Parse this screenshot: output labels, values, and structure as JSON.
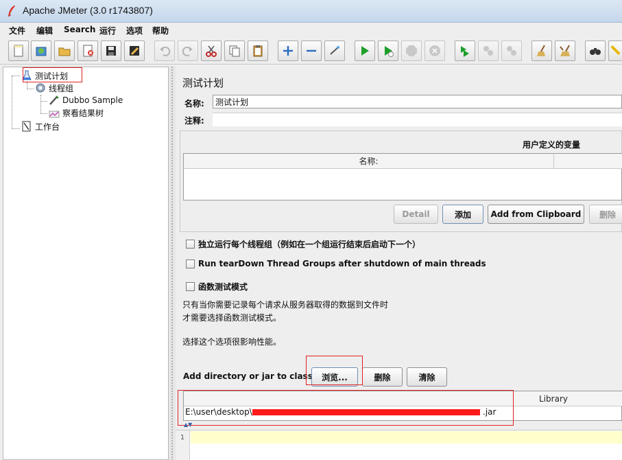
{
  "window": {
    "title": "Apache JMeter (3.0 r1743807)"
  },
  "menu": [
    "文件",
    "编辑",
    "Search",
    "运行",
    "选项",
    "帮助"
  ],
  "tree": {
    "items": [
      {
        "label": "测试计划",
        "icon": "test-plan-icon"
      },
      {
        "label": "线程组",
        "icon": "thread-group-icon"
      },
      {
        "label": "Dubbo Sample",
        "icon": "sampler-icon"
      },
      {
        "label": "察看结果树",
        "icon": "results-tree-icon"
      },
      {
        "label": "工作台",
        "icon": "workbench-icon"
      }
    ]
  },
  "panel": {
    "title": "测试计划",
    "name_label": "名称:",
    "name_value": "测试计划",
    "comment_label": "注释:",
    "comment_value": "",
    "vars_title": "用户定义的变量",
    "vars_column": "名称:",
    "buttons": {
      "detail": "Detail",
      "add": "添加",
      "add_clipboard": "Add from Clipboard",
      "delete": "删除"
    },
    "checkboxes": [
      {
        "label": "独立运行每个线程组（例如在一个组运行结束后启动下一个）",
        "checked": false
      },
      {
        "label": "Run tearDown Thread Groups after shutdown of main threads",
        "checked": false
      },
      {
        "label": "函数测试模式",
        "checked": false
      }
    ],
    "notes": [
      "只有当你需要记录每个请求从服务器取得的数据到文件时",
      "才需要选择函数测试模式。",
      "选择这个选项很影响性能。"
    ],
    "classpath_label": "Add directory or jar to classpath",
    "classpath_buttons": {
      "browse": "浏览...",
      "delete": "删除",
      "clear": "清除"
    },
    "library_column": "Library",
    "library_path_prefix": "E:\\user\\desktop\\n",
    "library_path_suffix": ".jar"
  },
  "editor": {
    "line_number": "1"
  },
  "colors": {
    "highlight_box": "#e02020",
    "redaction": "#ff1a1a",
    "editor_line": "#ffffcc"
  }
}
